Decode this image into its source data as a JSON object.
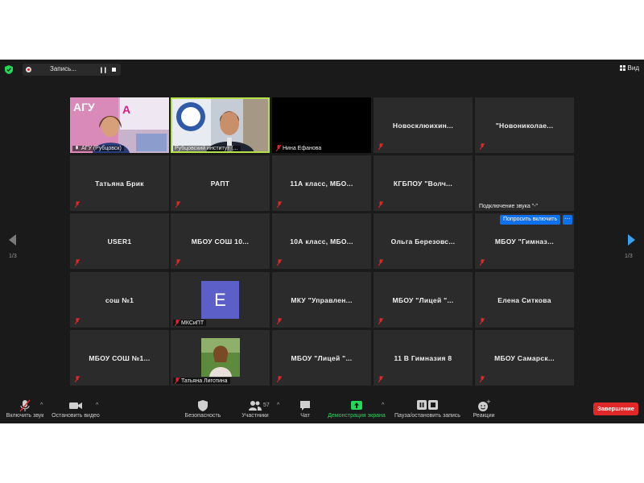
{
  "topbar": {
    "recording_label": "Запись...",
    "view_label": "Вид"
  },
  "tiles": [
    {
      "name": "",
      "label": "АГУ (Рубцовск)"
    },
    {
      "name": "",
      "label": "Рубцовский институт (..."
    },
    {
      "name": "",
      "label": "Нина Ефанова"
    },
    {
      "name": "Новосклюихин..."
    },
    {
      "name": "\"Новониколае..."
    },
    {
      "name": "Татьяна Брик"
    },
    {
      "name": "РАПТ"
    },
    {
      "name": "11А класс, МБО..."
    },
    {
      "name": "КГБПОУ \"Волч..."
    },
    {
      "name": "",
      "label": "Подключение звука \"-\""
    },
    {
      "name": "USER1"
    },
    {
      "name": "МБОУ СОШ 10..."
    },
    {
      "name": "10А класс, МБО..."
    },
    {
      "name": "Ольга Березовс..."
    },
    {
      "name": "МБОУ \"Гимназ..."
    },
    {
      "name": "сош №1"
    },
    {
      "name": "",
      "avatar_letter": "E",
      "label": "МКСиПТ"
    },
    {
      "name": "МКУ \"Управлен..."
    },
    {
      "name": "МБОУ \"Лицей \"..."
    },
    {
      "name": "Елена Ситкова"
    },
    {
      "name": "МБОУ СОШ №1..."
    },
    {
      "name": "",
      "label": "Татьяна Лиготина"
    },
    {
      "name": "МБОУ \"Лицей \"..."
    },
    {
      "name": "11 В Гимназия 8"
    },
    {
      "name": "МБОУ Самарск..."
    }
  ],
  "ask_unmute": {
    "label": "Попросить включить",
    "more": "···"
  },
  "pagination": {
    "left": "1/3",
    "right": "1/3"
  },
  "toolbar": {
    "unmute": "Включить звук",
    "stop_video": "Остановить видео",
    "security": "Безопасность",
    "participants": "Участники",
    "participants_count": "57",
    "chat": "Чат",
    "share": "Демонстрация экрана",
    "pause_rec": "Пауза/остановить запись",
    "reactions": "Реакции",
    "end": "Завершение"
  },
  "colors": {
    "share_green": "#23d959",
    "end_red": "#e02828",
    "accent_blue": "#0e71eb",
    "active_speaker": "#b4e04a"
  }
}
